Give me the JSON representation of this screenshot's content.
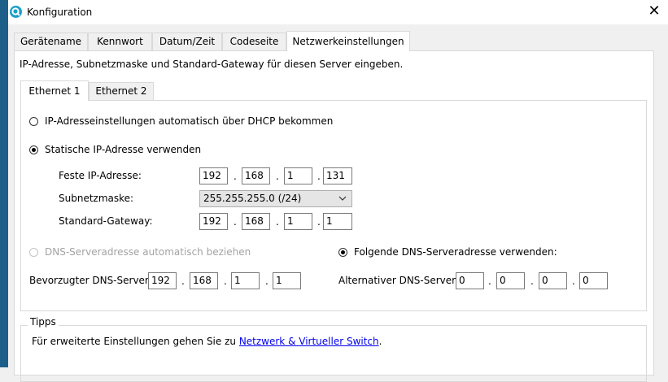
{
  "window": {
    "title": "Konfiguration"
  },
  "tabs": [
    "Gerätename",
    "Kennwort",
    "Datum/Zeit",
    "Codeseite",
    "Netzwerkeinstellungen"
  ],
  "description": "IP-Adresse, Subnetzmaske und Standard-Gateway für diesen Server eingeben.",
  "subtabs": [
    "Ethernet 1",
    "Ethernet 2"
  ],
  "dhcp_option": "IP-Adresseinstellungen automatisch über DHCP bekommen",
  "static_option": "Statische IP-Adresse verwenden",
  "fixed_ip": {
    "label": "Feste IP-Adresse:",
    "octets": [
      "192",
      "168",
      "1",
      "131"
    ]
  },
  "subnet": {
    "label": "Subnetzmaske:",
    "value": "255.255.255.0 (/24)"
  },
  "gateway": {
    "label": "Standard-Gateway:",
    "octets": [
      "192",
      "168",
      "1",
      "1"
    ]
  },
  "dns_auto_option": "DNS-Serveradresse automatisch beziehen",
  "dns_manual_option": "Folgende DNS-Serveradresse verwenden:",
  "preferred_dns": {
    "label": "Bevorzugter DNS-Server",
    "octets": [
      "192",
      "168",
      "1",
      "1"
    ]
  },
  "alternate_dns": {
    "label": "Alternativer DNS-Server",
    "octets": [
      "0",
      "0",
      "0",
      "0"
    ]
  },
  "tips": {
    "title": "Tipps",
    "text_before": "Für erweiterte Einstellungen gehen Sie zu ",
    "link": "Netzwerk & Virtueller Switch",
    "text_after": "."
  },
  "colors": {
    "accent": "#1e5f8a",
    "link": "#0000ee"
  }
}
